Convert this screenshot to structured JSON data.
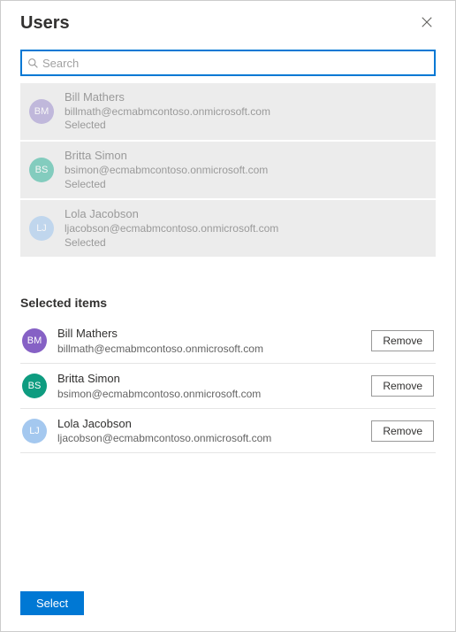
{
  "header": {
    "title": "Users"
  },
  "search": {
    "placeholder": "Search",
    "value": ""
  },
  "results": [
    {
      "initials": "BM",
      "name": "Bill Mathers",
      "email": "billmath@ecmabmcontoso.onmicrosoft.com",
      "status": "Selected",
      "avatar_color": "#a496d0"
    },
    {
      "initials": "BS",
      "name": "Britta Simon",
      "email": "bsimon@ecmabmcontoso.onmicrosoft.com",
      "status": "Selected",
      "avatar_color": "#3fb7a0"
    },
    {
      "initials": "LJ",
      "name": "Lola Jacobson",
      "email": "ljacobson@ecmabmcontoso.onmicrosoft.com",
      "status": "Selected",
      "avatar_color": "#a4c8ef"
    }
  ],
  "selected_section": {
    "heading": "Selected items",
    "remove_label": "Remove"
  },
  "selected": [
    {
      "initials": "BM",
      "name": "Bill Mathers",
      "email": "billmath@ecmabmcontoso.onmicrosoft.com",
      "avatar_color": "#8661c5"
    },
    {
      "initials": "BS",
      "name": "Britta Simon",
      "email": "bsimon@ecmabmcontoso.onmicrosoft.com",
      "avatar_color": "#0e9c80"
    },
    {
      "initials": "LJ",
      "name": "Lola Jacobson",
      "email": "ljacobson@ecmabmcontoso.onmicrosoft.com",
      "avatar_color": "#a4c8ef"
    }
  ],
  "footer": {
    "select_label": "Select"
  }
}
